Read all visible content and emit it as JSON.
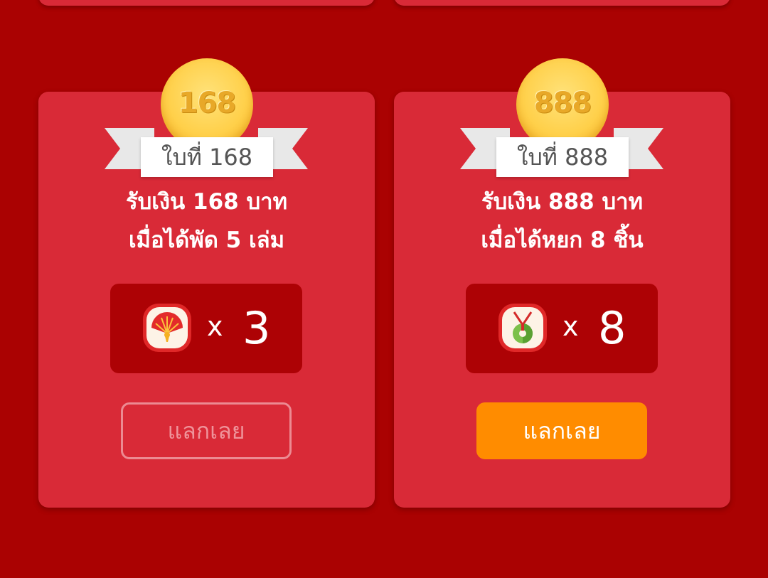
{
  "cards": [
    {
      "coin_number": "168",
      "ribbon_label": "ใบที่ 168",
      "reward_line": "รับเงิน 168 บาท",
      "condition_line": "เมื่อได้พัด 5 เล่ม",
      "item_icon": "fan-icon",
      "times_symbol": "x",
      "count": "3",
      "button_label": "แลกเลย",
      "button_state": "disabled"
    },
    {
      "coin_number": "888",
      "ribbon_label": "ใบที่ 888",
      "reward_line": "รับเงิน 888 บาท",
      "condition_line": "เมื่อได้หยก 8 ชิ้น",
      "item_icon": "jade-pendant-icon",
      "times_symbol": "x",
      "count": "8",
      "button_label": "แลกเลย",
      "button_state": "enabled"
    }
  ],
  "colors": {
    "background": "#aa0202",
    "card": "#d92a37",
    "count_box": "#ad0205",
    "button_active": "#ff8c00",
    "button_disabled_border": "#ec8a92",
    "coin_gold": "#ffd04a"
  }
}
